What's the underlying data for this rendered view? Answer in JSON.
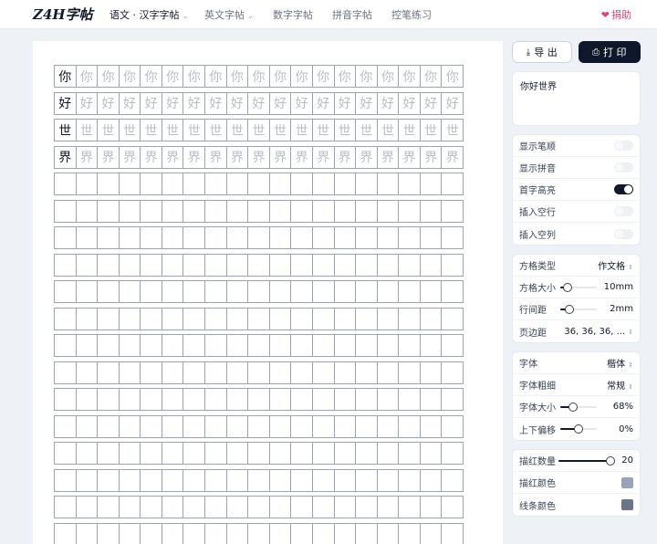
{
  "nav": {
    "logo": "Z4H字帖",
    "items": [
      {
        "label": "语文 · 汉字字帖",
        "dropdown": true,
        "active": true
      },
      {
        "label": "英文字帖",
        "dropdown": true,
        "active": false
      },
      {
        "label": "数字字帖",
        "dropdown": false,
        "active": false
      },
      {
        "label": "拼音字帖",
        "dropdown": false,
        "active": false
      },
      {
        "label": "控笔练习",
        "dropdown": false,
        "active": false
      }
    ],
    "donate": "捐助"
  },
  "practice": {
    "characters": [
      "你",
      "好",
      "世",
      "界"
    ],
    "columns": 19,
    "empty_rows": 14
  },
  "actions": {
    "export": "导 出",
    "print": "打 印"
  },
  "input_text": "你好世界",
  "toggles": [
    {
      "label": "显示笔顺",
      "on": false
    },
    {
      "label": "显示拼音",
      "on": false
    },
    {
      "label": "首字高亮",
      "on": true
    },
    {
      "label": "插入空行",
      "on": false
    },
    {
      "label": "插入空列",
      "on": false
    }
  ],
  "grid_settings": {
    "type": {
      "label": "方格类型",
      "value": "作文格"
    },
    "size": {
      "label": "方格大小",
      "value": "10mm",
      "level": 0.1
    },
    "line_spacing": {
      "label": "行间距",
      "value": "2mm",
      "level": 0.15
    },
    "margin": {
      "label": "页边距",
      "value": "36, 36, 36, ..."
    }
  },
  "font_settings": {
    "font": {
      "label": "字体",
      "value": "楷体"
    },
    "weight": {
      "label": "字体粗细",
      "value": "常规"
    },
    "size": {
      "label": "字体大小",
      "value": "68%",
      "level": 0.3
    },
    "offset": {
      "label": "上下偏移",
      "value": "0%",
      "level": 0.5
    }
  },
  "trace_settings": {
    "count": {
      "label": "描红数量",
      "value": "20",
      "level": 1.0
    },
    "trace_color": {
      "label": "描红颜色",
      "color": "#9aa3b5"
    },
    "line_color": {
      "label": "线条颜色",
      "color": "#6b7587"
    }
  },
  "colors": {
    "primary": "#0f172a",
    "donate": "#e0457b",
    "grid_line": "#9aa4b2",
    "trace_text": "#b8bec9"
  }
}
